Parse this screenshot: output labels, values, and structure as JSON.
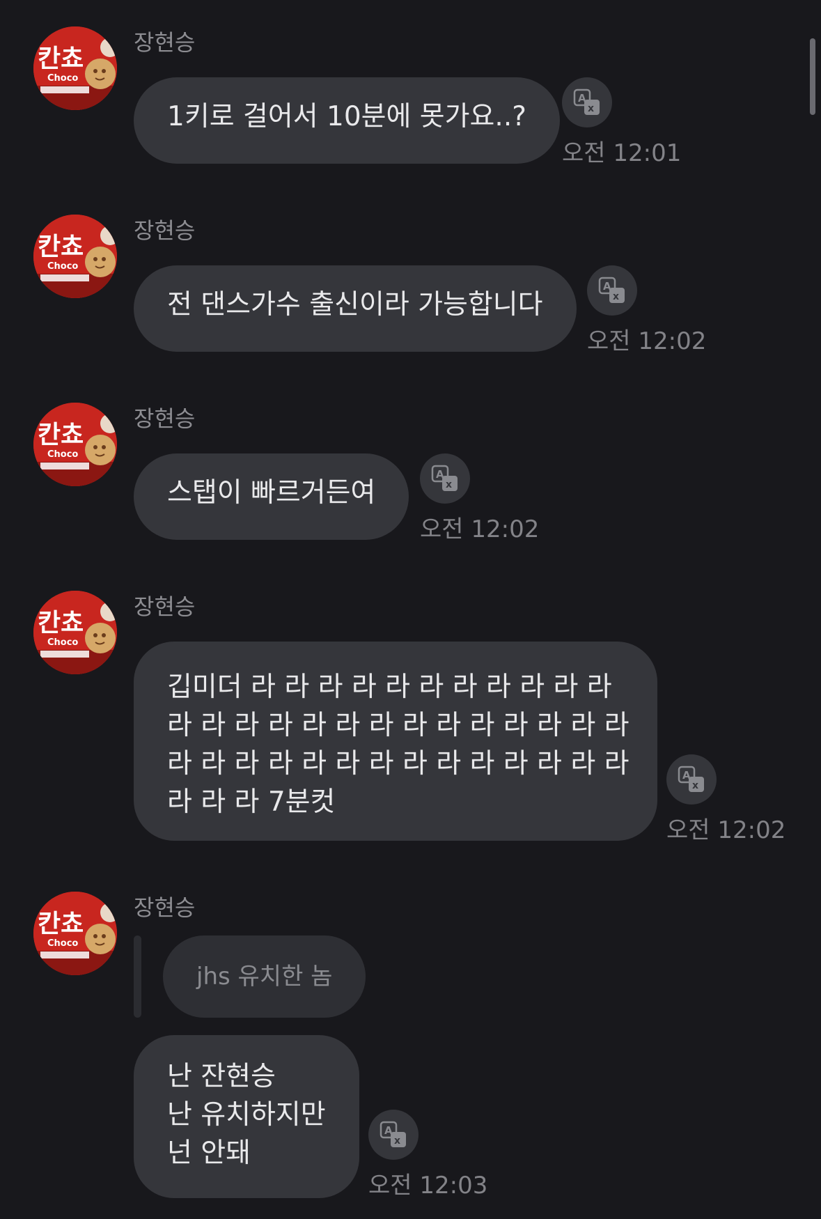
{
  "messages": [
    {
      "sender": "장현승",
      "lines": [
        "1키로 걸어서 10분에 못가요..?"
      ],
      "time": "오전 12:01"
    },
    {
      "sender": "장현승",
      "lines": [
        "전 댄스가수 출신이라 가능합니다"
      ],
      "time": "오전 12:02"
    },
    {
      "sender": "장현승",
      "lines": [
        "스탭이 빠르거든여"
      ],
      "time": "오전 12:02"
    },
    {
      "sender": "장현승",
      "lines": [
        "깁미더 라 라 라 라 라 라 라 라 라 라 라",
        "라 라 라 라 라 라 라 라 라 라 라 라 라 라",
        "라 라 라 라 라 라 라 라 라 라 라 라 라 라",
        "라 라 라 7분컷"
      ],
      "time": "오전 12:02"
    },
    {
      "sender": "장현승",
      "reply_quote": "jhs 유치한 놈",
      "lines": [
        "난 잔현승",
        "난 유치하지만",
        "넌 안돼"
      ],
      "time": "오전 12:03"
    }
  ],
  "avatar": {
    "icon": "snack-package-avatar",
    "logo_text": "칸쵸",
    "sub_text": "Choco"
  },
  "translate_icon": "translate-icon",
  "colors": {
    "background": "#18181c",
    "bubble": "#35363b",
    "reply_bubble": "#2e2f34",
    "text": "#e9e9eb",
    "meta_text": "#8d8d92"
  }
}
